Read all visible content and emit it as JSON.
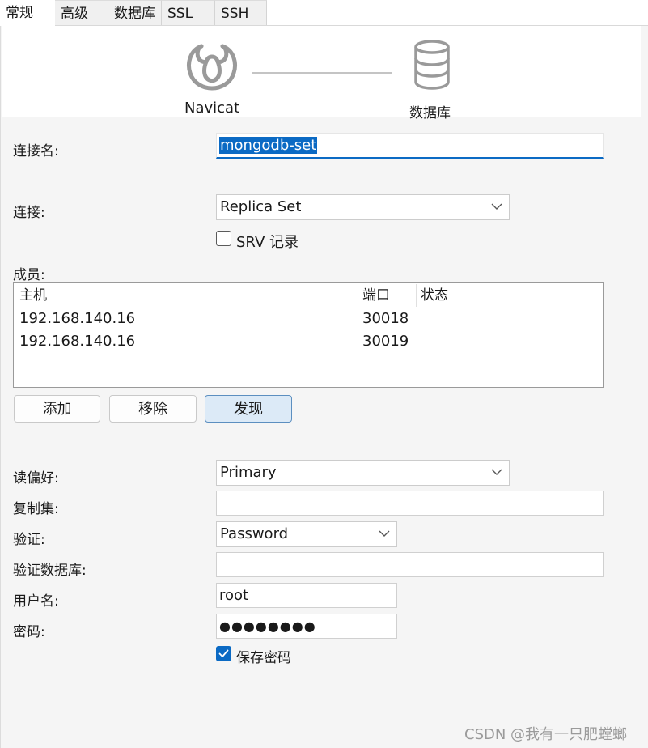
{
  "tabs": [
    {
      "label": "常规",
      "active": true
    },
    {
      "label": "高级",
      "active": false
    },
    {
      "label": "数据库",
      "active": false
    },
    {
      "label": "SSL",
      "active": false
    },
    {
      "label": "SSH",
      "active": false
    }
  ],
  "banner": {
    "client_label": "Navicat",
    "server_label": "数据库"
  },
  "connection_name": {
    "label": "连接名:",
    "value": "mongodb-set"
  },
  "connection": {
    "label": "连接:",
    "value": "Replica Set"
  },
  "srv_record": {
    "label": "SRV 记录",
    "checked": false
  },
  "members": {
    "label": "成员:",
    "columns": [
      "主机",
      "端口",
      "状态"
    ],
    "rows": [
      {
        "host": "192.168.140.16",
        "port": "30018",
        "status": ""
      },
      {
        "host": "192.168.140.16",
        "port": "30019",
        "status": ""
      }
    ]
  },
  "member_buttons": {
    "add": "添加",
    "remove": "移除",
    "discover": "发现"
  },
  "read_preference": {
    "label": "读偏好:",
    "value": "Primary"
  },
  "replica_set": {
    "label": "复制集:",
    "value": ""
  },
  "auth": {
    "label": "验证:",
    "value": "Password"
  },
  "auth_db": {
    "label": "验证数据库:",
    "value": ""
  },
  "username": {
    "label": "用户名:",
    "value": "root"
  },
  "password": {
    "label": "密码:",
    "value": "●●●●●●●●"
  },
  "save_password": {
    "label": "保存密码",
    "checked": true
  },
  "watermark": "CSDN @我有一只肥螳螂",
  "colors": {
    "accent": "#0b6ac4",
    "panel": "#f5f5f5",
    "button_primary": "#dceaf7"
  }
}
